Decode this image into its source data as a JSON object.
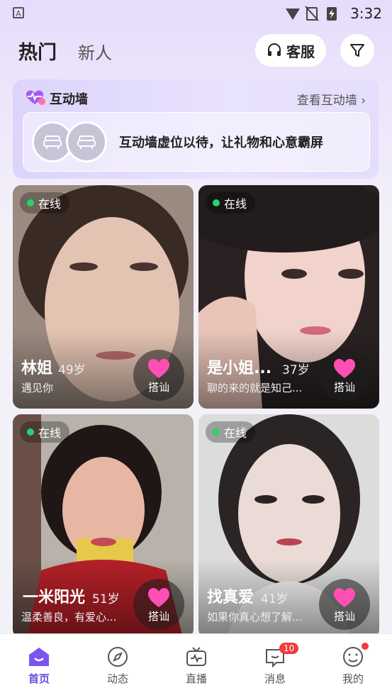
{
  "status_bar": {
    "time": "3:32",
    "app_icon_letter": "A"
  },
  "header": {
    "tabs": [
      {
        "label": "热门",
        "active": true
      },
      {
        "label": "新人",
        "active": false
      }
    ],
    "customer_service_label": "客服"
  },
  "interaction_wall": {
    "title": "互动墙",
    "link_label": "查看互动墙",
    "placeholder_text": "互动墙虚位以待，让礼物和心意霸屏"
  },
  "cards": [
    {
      "status": "在线",
      "name": "林姐",
      "age": "49岁",
      "intro": "遇见你",
      "greet_label": "搭讪"
    },
    {
      "status": "在线",
      "name": "是小姐...",
      "age": "37岁",
      "intro": "聊的来的就是知己...",
      "greet_label": "搭讪"
    },
    {
      "status": "在线",
      "name": "一米阳光",
      "age": "51岁",
      "intro": "温柔善良，有爱心...",
      "greet_label": "搭讪"
    },
    {
      "status": "在线",
      "name": "找真爱",
      "age": "41岁",
      "intro": "如果你真心想了解...",
      "greet_label": "搭讪"
    }
  ],
  "nav": {
    "items": [
      {
        "label": "首页",
        "icon": "home-icon",
        "active": true
      },
      {
        "label": "动态",
        "icon": "compass-icon"
      },
      {
        "label": "直播",
        "icon": "tv-icon"
      },
      {
        "label": "消息",
        "icon": "message-icon",
        "badge": "10"
      },
      {
        "label": "我的",
        "icon": "profile-icon"
      }
    ]
  },
  "colors": {
    "accent": "#6b4ce6",
    "online": "#27d36b",
    "badge": "#f23b3b"
  }
}
